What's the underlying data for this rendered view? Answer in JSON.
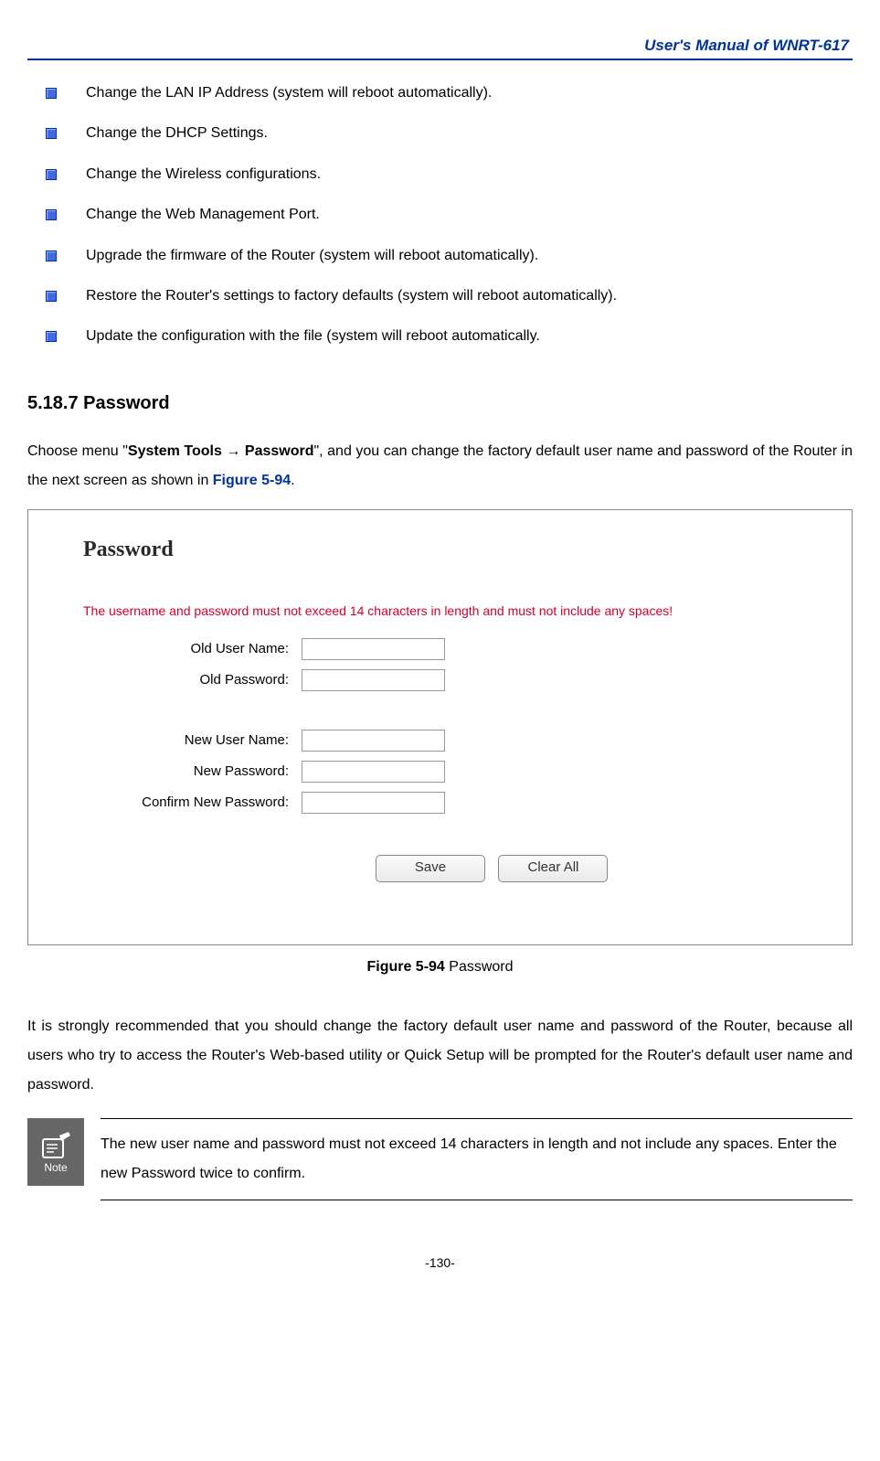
{
  "header": {
    "title": "User's Manual of WNRT-617"
  },
  "bullets": {
    "items": [
      "Change the LAN IP Address (system will reboot automatically).",
      "Change the DHCP Settings.",
      "Change the Wireless configurations.",
      "Change the Web Management Port.",
      "Upgrade the firmware of the Router (system will reboot automatically).",
      "Restore the Router's settings to factory defaults (system will reboot automatically).",
      "Update the configuration with the file (system will reboot automatically."
    ]
  },
  "section": {
    "heading": "5.18.7   Password"
  },
  "intro": {
    "prefix": "Choose menu \"",
    "bold": "System Tools  →  Password",
    "mid": "\", and you can change the factory default user name and password of the Router in the next screen as shown in ",
    "link": "Figure 5-94",
    "suffix": "."
  },
  "figure": {
    "title": "Password",
    "notice": "The username and password must not exceed 14 characters in length and must not include any spaces!",
    "labels": {
      "old_user": "Old User Name:",
      "old_pass": "Old Password:",
      "new_user": "New User Name:",
      "new_pass": "New Password:",
      "confirm": "Confirm New Password:"
    },
    "buttons": {
      "save": "Save",
      "clear": "Clear All"
    }
  },
  "caption": {
    "bold": "Figure 5-94",
    "text": "    Password"
  },
  "recommend": "It is strongly recommended that you should change the factory default user name and password of the Router, because all users who try to access the Router's Web-based utility or Quick Setup will be prompted for the Router's default user name and password.",
  "note": {
    "label": "Note",
    "text": "The new user name and password must not exceed 14 characters in length and not include any spaces. Enter the new Password twice to confirm."
  },
  "page": {
    "number": "-130-"
  }
}
